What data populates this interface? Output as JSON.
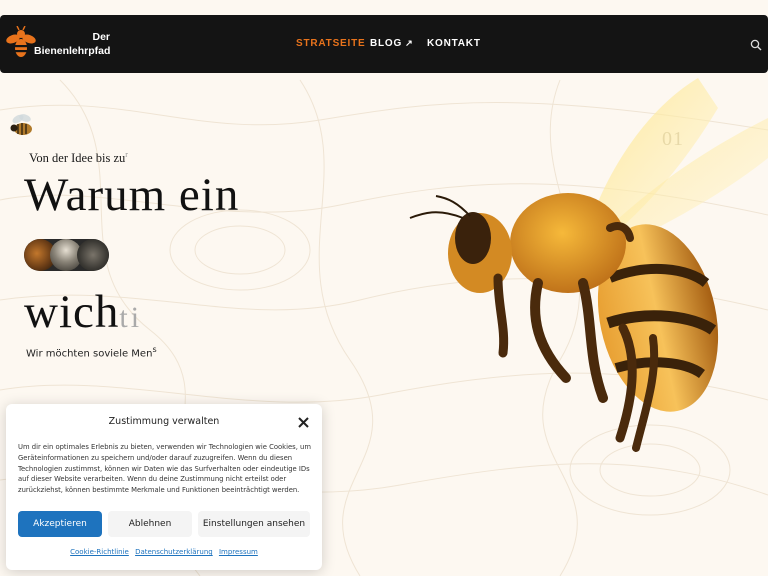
{
  "header": {
    "logo": {
      "line1": "Der",
      "line2": "Bienenlehrpfad"
    },
    "nav": [
      {
        "label": "STRATSEITE",
        "active": true
      },
      {
        "label": "BLOG",
        "external_icon": "↗"
      },
      {
        "label": "KONTAKT"
      }
    ],
    "search_icon": "search-icon"
  },
  "hero": {
    "subtitle": "Von der Idee bis zu",
    "subtitle_fade": "r",
    "headline_1": "Warum ein",
    "headline_2": "wich",
    "headline_2_fade": "ti",
    "text": "Wir möchten soviele Men",
    "text_fade": "s",
    "counter": "01"
  },
  "consent": {
    "title": "Zustimmung verwalten",
    "body": "Um dir ein optimales Erlebnis zu bieten, verwenden wir Technologien wie Cookies, um Geräteinformationen zu speichern und/oder darauf zuzugreifen. Wenn du diesen Technologien zustimmst, können wir Daten wie das Surfverhalten oder eindeutige IDs auf dieser Website verarbeiten. Wenn du deine Zustimmung nicht erteilst oder zurückziehst, können bestimmte Merkmale und Funktionen beeinträchtigt werden.",
    "accept_label": "Akzeptieren",
    "decline_label": "Ablehnen",
    "settings_label": "Einstellungen ansehen",
    "links": [
      "Cookie-Richtlinie",
      "Datenschutzerklärung",
      "Impressum"
    ]
  },
  "colors": {
    "accent": "#e8731c",
    "header_bg": "#141414",
    "page_bg": "#fdf8f1",
    "button_primary": "#1e73be"
  }
}
